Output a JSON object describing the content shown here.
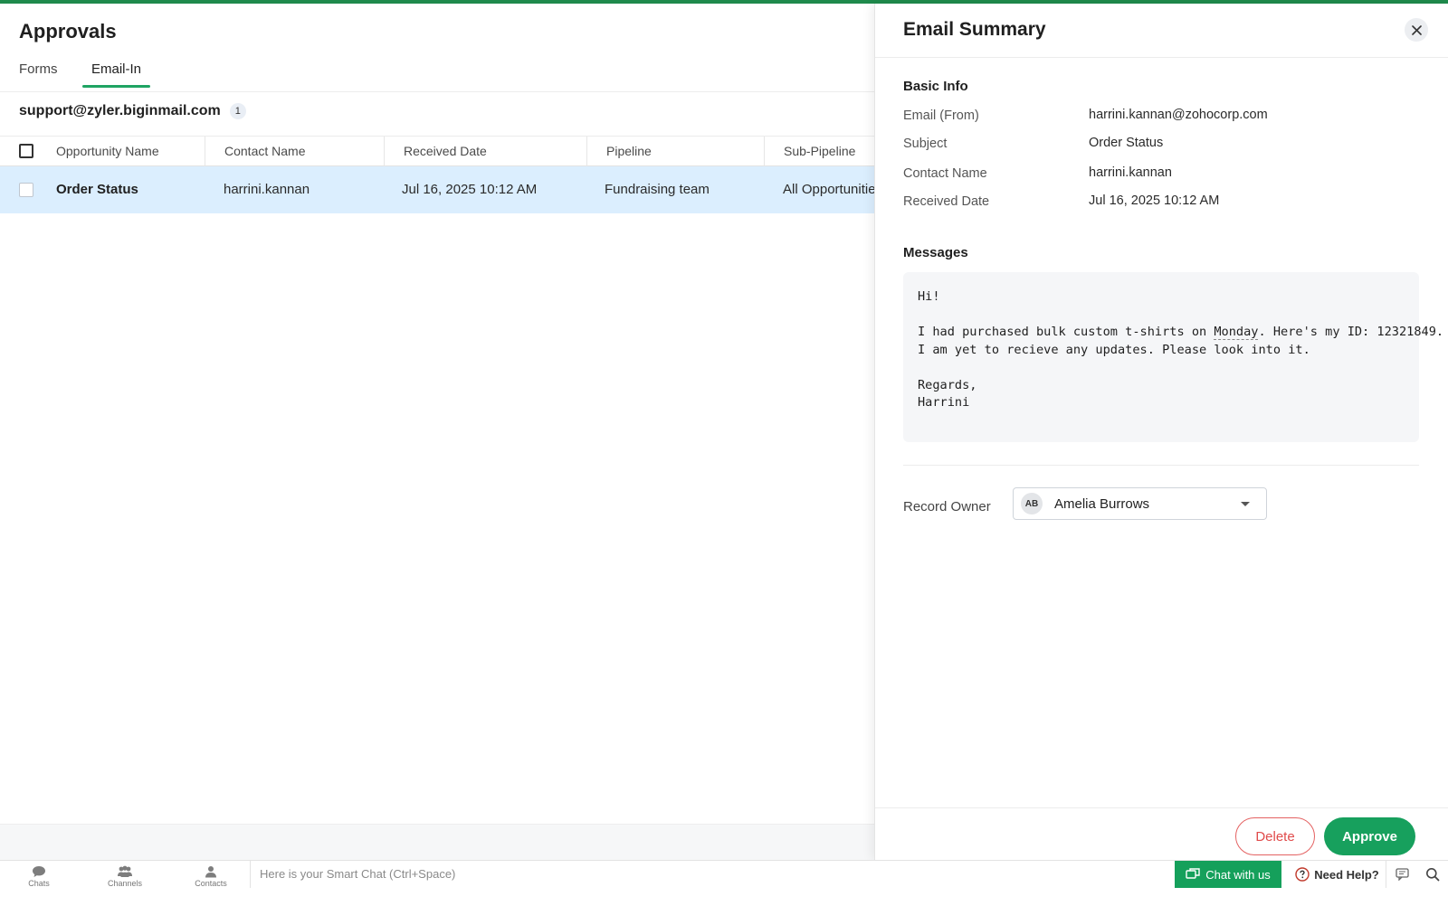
{
  "app": {
    "accent": "#1fa463",
    "selected_row_bg": "#dbeefe"
  },
  "page": {
    "title": "Approvals"
  },
  "tabs": [
    {
      "label": "Forms",
      "active": false
    },
    {
      "label": "Email-In",
      "active": true
    }
  ],
  "mailbox": {
    "email": "support@zyler.biginmail.com",
    "count": "1"
  },
  "table": {
    "columns": [
      "Opportunity Name",
      "Contact Name",
      "Received Date",
      "Pipeline",
      "Sub-Pipeline"
    ],
    "rows": [
      {
        "opportunity": "Order Status",
        "contact": "harrini.kannan",
        "received": "Jul 16, 2025 10:12 AM",
        "pipeline": "Fundraising team",
        "sub_pipeline": "All Opportunities"
      }
    ]
  },
  "panel": {
    "title": "Email Summary",
    "basic_info": {
      "heading": "Basic Info",
      "fields": [
        {
          "label": "Email (From)",
          "value": "harrini.kannan@zohocorp.com"
        },
        {
          "label": "Subject",
          "value": "Order Status"
        },
        {
          "label": "Contact Name",
          "value": "harrini.kannan"
        },
        {
          "label": "Received Date",
          "value": "Jul 16, 2025 10:12 AM"
        }
      ]
    },
    "messages": {
      "heading": "Messages",
      "greeting": "Hi!",
      "line1_before": "I had purchased bulk custom t-shirts on ",
      "line1_highlight": "Monday",
      "line1_after": ". Here's my ID: 12321849.",
      "line2": "I am yet to recieve any updates. Please look into it.",
      "signoff": "Regards,",
      "name": "Harrini"
    },
    "record_owner": {
      "label": "Record Owner",
      "initials": "AB",
      "name": "Amelia Burrows"
    },
    "buttons": {
      "delete": "Delete",
      "approve": "Approve"
    }
  },
  "bottom_bar": {
    "items": [
      {
        "label": "Chats",
        "icon": "chat-bubble-icon"
      },
      {
        "label": "Channels",
        "icon": "channels-icon"
      },
      {
        "label": "Contacts",
        "icon": "contact-icon"
      }
    ],
    "smart_chat_placeholder": "Here is your Smart Chat (Ctrl+Space)",
    "chat_with_us": "Chat with us",
    "need_help": "Need Help?"
  }
}
